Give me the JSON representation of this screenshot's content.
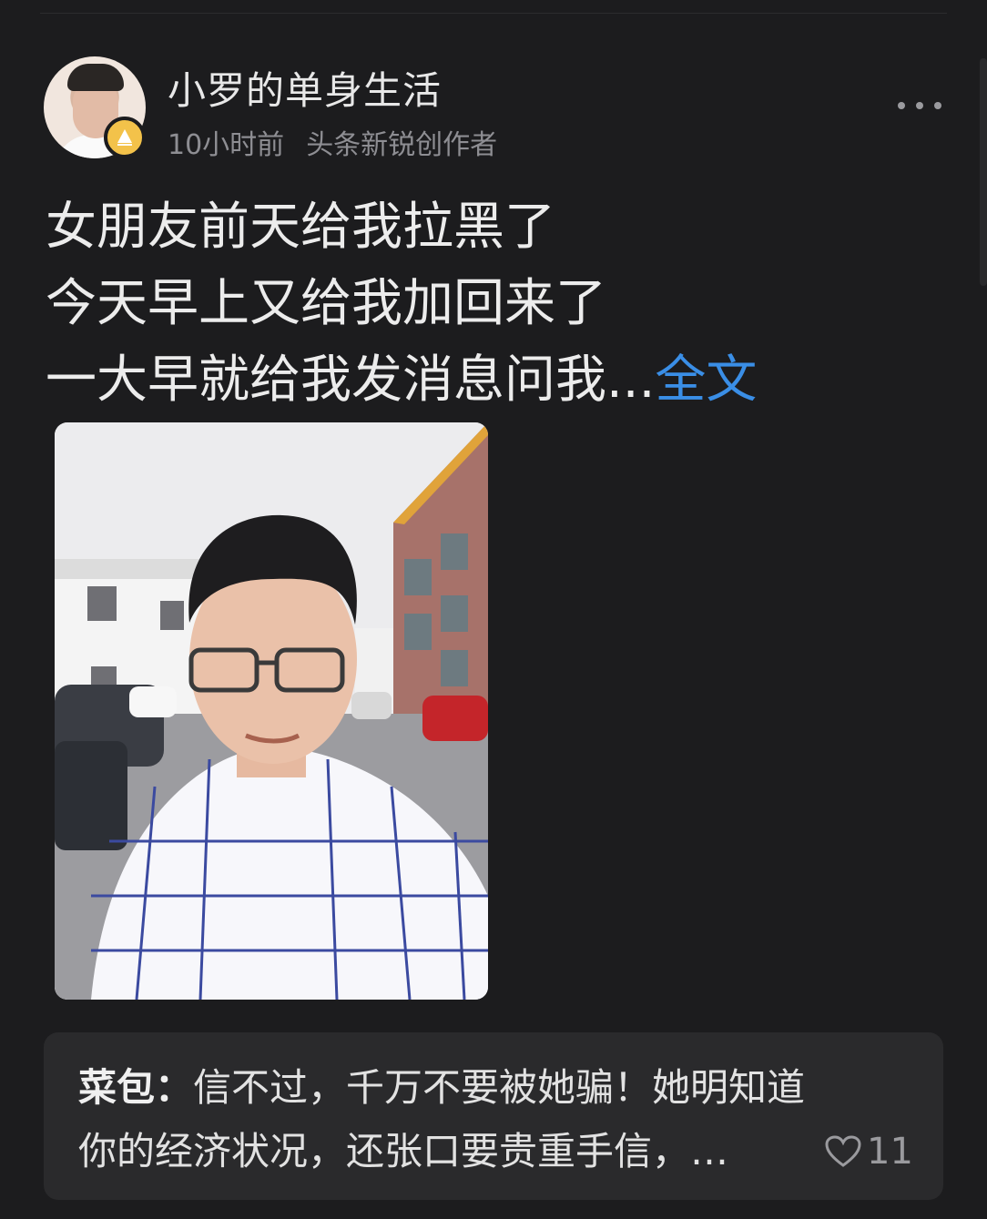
{
  "author": {
    "name": "小罗的单身生活",
    "time": "10小时前",
    "title": "头条新锐创作者"
  },
  "post": {
    "lines": [
      "女朋友前天给我拉黑了",
      "今天早上又给我加回来了",
      "一大早就给我发消息问我..."
    ],
    "full_text_link": "全文"
  },
  "comment": {
    "author": "菜包：",
    "line1": "信不过，千万不要被她骗！她明知道",
    "line2": "你的经济状况，还张口要贵重手信，…",
    "likes": "11"
  },
  "icons": {
    "badge": "creator-badge-icon",
    "more": "more-dots-icon",
    "like": "heart-icon"
  },
  "colors": {
    "background": "#1c1c1e",
    "link": "#3a8ee6",
    "badge": "#f3c24a",
    "comment_bg": "#2a2a2c"
  }
}
